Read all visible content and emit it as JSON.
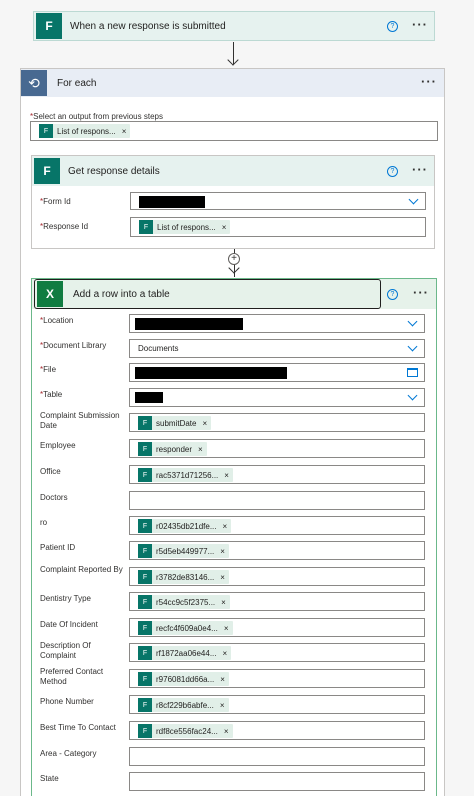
{
  "trigger": {
    "title": "When a new response is submitted",
    "help": "?",
    "more": "···"
  },
  "foreach": {
    "title": "For each",
    "more": "···",
    "select_label": "Select an output from previous steps",
    "token": "List of respons...",
    "token_x": "×"
  },
  "get_details": {
    "title": "Get response details",
    "help": "?",
    "more": "···",
    "form_id_label": "Form Id",
    "response_id_label": "Response Id",
    "response_token": "List of respons...",
    "token_x": "×"
  },
  "add_row": {
    "title": "Add a row into a table",
    "help": "?",
    "more": "···",
    "rows": [
      {
        "label": "Location",
        "required": true
      },
      {
        "label": "Document Library",
        "required": true,
        "value": "Documents"
      },
      {
        "label": "File",
        "required": true
      },
      {
        "label": "Table",
        "required": true
      },
      {
        "label": "Complaint Submission Date",
        "token": "submitDate"
      },
      {
        "label": "Employee",
        "token": "responder"
      },
      {
        "label": "Office",
        "token": "rac5371d71256..."
      },
      {
        "label": "Doctors"
      },
      {
        "label": "ro",
        "token": "r02435db21dfe..."
      },
      {
        "label": "Patient ID",
        "token": "r5d5eb449977..."
      },
      {
        "label": "Complaint Reported By",
        "token": "r3782de83146..."
      },
      {
        "label": "Dentistry Type",
        "token": "r54cc9c5f2375..."
      },
      {
        "label": "Date Of Incident",
        "token": "recfc4f609a0e4..."
      },
      {
        "label": "Description Of Complaint",
        "token": "rf1872aa06e44..."
      },
      {
        "label": "Preferred Contact Method",
        "token": "r976081dd66a..."
      },
      {
        "label": "Phone Number",
        "token": "r8cf229b6abfe..."
      },
      {
        "label": "Best Time To Contact",
        "token": "rdf8ce556fac24..."
      },
      {
        "label": "Area - Category"
      },
      {
        "label": "State"
      }
    ]
  },
  "colors": {
    "forms": "#077568",
    "excel": "#107c41",
    "loop": "#486991",
    "accent": "#0078d4"
  },
  "icons": {
    "forms": "forms-icon",
    "excel": "excel-icon",
    "loop": "loop-icon",
    "help": "help-icon",
    "more": "more-icon",
    "close": "close-icon",
    "chevron": "chevron-down-icon",
    "file": "folder-icon",
    "add": "add-step-icon"
  }
}
